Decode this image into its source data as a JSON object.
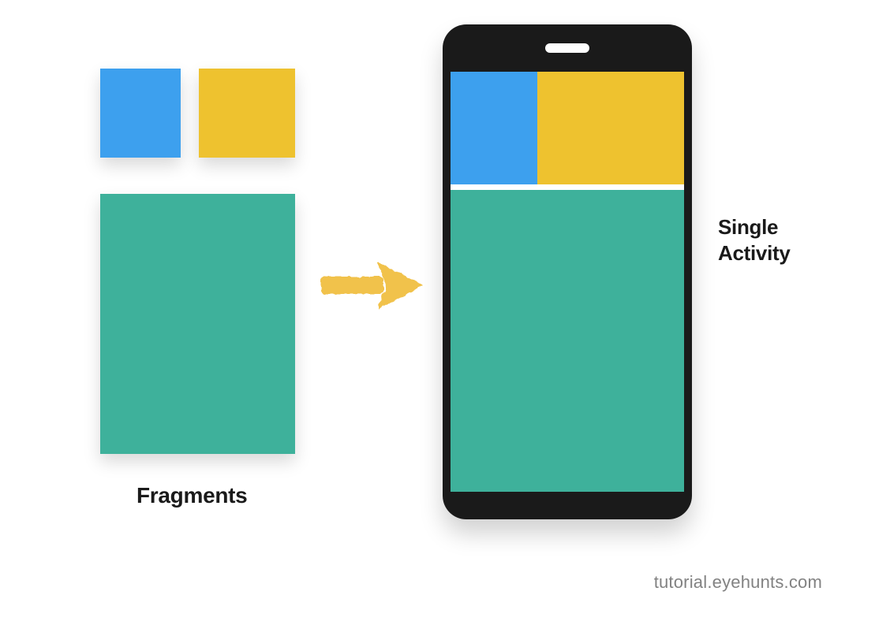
{
  "labels": {
    "fragments": "Fragments",
    "activity_line1": "Single",
    "activity_line2": "Activity"
  },
  "footer": {
    "site": "tutorial.eyehunts.com"
  },
  "colors": {
    "blue": "#3da0ee",
    "yellow": "#eec22f",
    "teal": "#3eb19b",
    "phone_body": "#1a1a1a",
    "arrow": "#f1c24b"
  },
  "diagram": {
    "description": "Three UI fragments (blue, yellow, teal) combine via arrow into a single phone Activity screen showing the same three colored regions."
  }
}
